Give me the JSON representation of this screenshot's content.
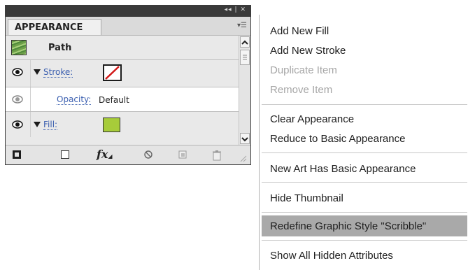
{
  "panel": {
    "tab_label": "APPEARANCE",
    "collapse_icon": "collapse-arrows-icon",
    "close_icon": "close-icon",
    "menu_icon": "panel-menu-icon",
    "path_label": "Path",
    "stroke_label": "Stroke:",
    "opacity_label": "Opacity:",
    "opacity_value": "Default",
    "fill_label": "Fill:",
    "fill_color": "#a7cc3a",
    "fx_label": "fx"
  },
  "menu": {
    "items": [
      {
        "label": "Add New Fill",
        "enabled": true
      },
      {
        "label": "Add New Stroke",
        "enabled": true
      },
      {
        "label": "Duplicate Item",
        "enabled": false
      },
      {
        "label": "Remove Item",
        "enabled": false
      },
      {
        "label": "Clear Appearance",
        "enabled": true
      },
      {
        "label": "Reduce to Basic Appearance",
        "enabled": true
      },
      {
        "label": "New Art Has Basic Appearance",
        "enabled": true
      },
      {
        "label": "Hide Thumbnail",
        "enabled": true
      },
      {
        "label": "Redefine Graphic Style \"Scribble\"",
        "enabled": true,
        "highlighted": true
      },
      {
        "label": "Show All Hidden Attributes",
        "enabled": true
      }
    ]
  }
}
